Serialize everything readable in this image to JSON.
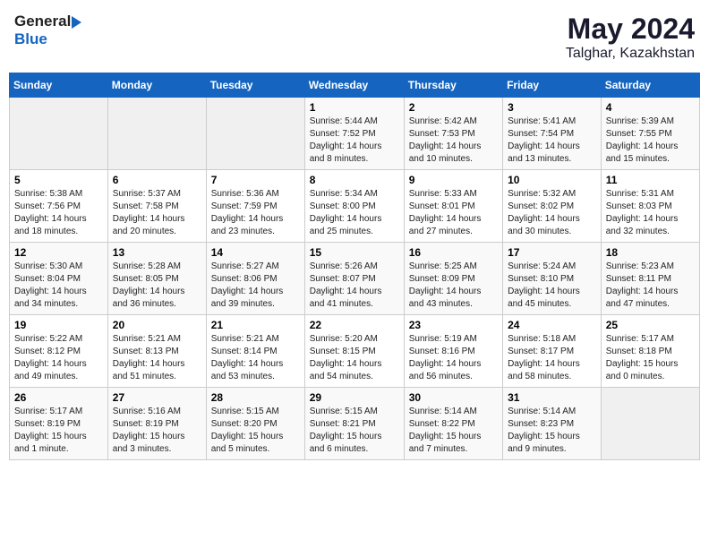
{
  "header": {
    "logo_general": "General",
    "logo_blue": "Blue",
    "month_year": "May 2024",
    "location": "Talghar, Kazakhstan"
  },
  "weekdays": [
    "Sunday",
    "Monday",
    "Tuesday",
    "Wednesday",
    "Thursday",
    "Friday",
    "Saturday"
  ],
  "weeks": [
    [
      {
        "day": "",
        "info": ""
      },
      {
        "day": "",
        "info": ""
      },
      {
        "day": "",
        "info": ""
      },
      {
        "day": "1",
        "info": "Sunrise: 5:44 AM\nSunset: 7:52 PM\nDaylight: 14 hours\nand 8 minutes."
      },
      {
        "day": "2",
        "info": "Sunrise: 5:42 AM\nSunset: 7:53 PM\nDaylight: 14 hours\nand 10 minutes."
      },
      {
        "day": "3",
        "info": "Sunrise: 5:41 AM\nSunset: 7:54 PM\nDaylight: 14 hours\nand 13 minutes."
      },
      {
        "day": "4",
        "info": "Sunrise: 5:39 AM\nSunset: 7:55 PM\nDaylight: 14 hours\nand 15 minutes."
      }
    ],
    [
      {
        "day": "5",
        "info": "Sunrise: 5:38 AM\nSunset: 7:56 PM\nDaylight: 14 hours\nand 18 minutes."
      },
      {
        "day": "6",
        "info": "Sunrise: 5:37 AM\nSunset: 7:58 PM\nDaylight: 14 hours\nand 20 minutes."
      },
      {
        "day": "7",
        "info": "Sunrise: 5:36 AM\nSunset: 7:59 PM\nDaylight: 14 hours\nand 23 minutes."
      },
      {
        "day": "8",
        "info": "Sunrise: 5:34 AM\nSunset: 8:00 PM\nDaylight: 14 hours\nand 25 minutes."
      },
      {
        "day": "9",
        "info": "Sunrise: 5:33 AM\nSunset: 8:01 PM\nDaylight: 14 hours\nand 27 minutes."
      },
      {
        "day": "10",
        "info": "Sunrise: 5:32 AM\nSunset: 8:02 PM\nDaylight: 14 hours\nand 30 minutes."
      },
      {
        "day": "11",
        "info": "Sunrise: 5:31 AM\nSunset: 8:03 PM\nDaylight: 14 hours\nand 32 minutes."
      }
    ],
    [
      {
        "day": "12",
        "info": "Sunrise: 5:30 AM\nSunset: 8:04 PM\nDaylight: 14 hours\nand 34 minutes."
      },
      {
        "day": "13",
        "info": "Sunrise: 5:28 AM\nSunset: 8:05 PM\nDaylight: 14 hours\nand 36 minutes."
      },
      {
        "day": "14",
        "info": "Sunrise: 5:27 AM\nSunset: 8:06 PM\nDaylight: 14 hours\nand 39 minutes."
      },
      {
        "day": "15",
        "info": "Sunrise: 5:26 AM\nSunset: 8:07 PM\nDaylight: 14 hours\nand 41 minutes."
      },
      {
        "day": "16",
        "info": "Sunrise: 5:25 AM\nSunset: 8:09 PM\nDaylight: 14 hours\nand 43 minutes."
      },
      {
        "day": "17",
        "info": "Sunrise: 5:24 AM\nSunset: 8:10 PM\nDaylight: 14 hours\nand 45 minutes."
      },
      {
        "day": "18",
        "info": "Sunrise: 5:23 AM\nSunset: 8:11 PM\nDaylight: 14 hours\nand 47 minutes."
      }
    ],
    [
      {
        "day": "19",
        "info": "Sunrise: 5:22 AM\nSunset: 8:12 PM\nDaylight: 14 hours\nand 49 minutes."
      },
      {
        "day": "20",
        "info": "Sunrise: 5:21 AM\nSunset: 8:13 PM\nDaylight: 14 hours\nand 51 minutes."
      },
      {
        "day": "21",
        "info": "Sunrise: 5:21 AM\nSunset: 8:14 PM\nDaylight: 14 hours\nand 53 minutes."
      },
      {
        "day": "22",
        "info": "Sunrise: 5:20 AM\nSunset: 8:15 PM\nDaylight: 14 hours\nand 54 minutes."
      },
      {
        "day": "23",
        "info": "Sunrise: 5:19 AM\nSunset: 8:16 PM\nDaylight: 14 hours\nand 56 minutes."
      },
      {
        "day": "24",
        "info": "Sunrise: 5:18 AM\nSunset: 8:17 PM\nDaylight: 14 hours\nand 58 minutes."
      },
      {
        "day": "25",
        "info": "Sunrise: 5:17 AM\nSunset: 8:18 PM\nDaylight: 15 hours\nand 0 minutes."
      }
    ],
    [
      {
        "day": "26",
        "info": "Sunrise: 5:17 AM\nSunset: 8:19 PM\nDaylight: 15 hours\nand 1 minute."
      },
      {
        "day": "27",
        "info": "Sunrise: 5:16 AM\nSunset: 8:19 PM\nDaylight: 15 hours\nand 3 minutes."
      },
      {
        "day": "28",
        "info": "Sunrise: 5:15 AM\nSunset: 8:20 PM\nDaylight: 15 hours\nand 5 minutes."
      },
      {
        "day": "29",
        "info": "Sunrise: 5:15 AM\nSunset: 8:21 PM\nDaylight: 15 hours\nand 6 minutes."
      },
      {
        "day": "30",
        "info": "Sunrise: 5:14 AM\nSunset: 8:22 PM\nDaylight: 15 hours\nand 7 minutes."
      },
      {
        "day": "31",
        "info": "Sunrise: 5:14 AM\nSunset: 8:23 PM\nDaylight: 15 hours\nand 9 minutes."
      },
      {
        "day": "",
        "info": ""
      }
    ]
  ]
}
